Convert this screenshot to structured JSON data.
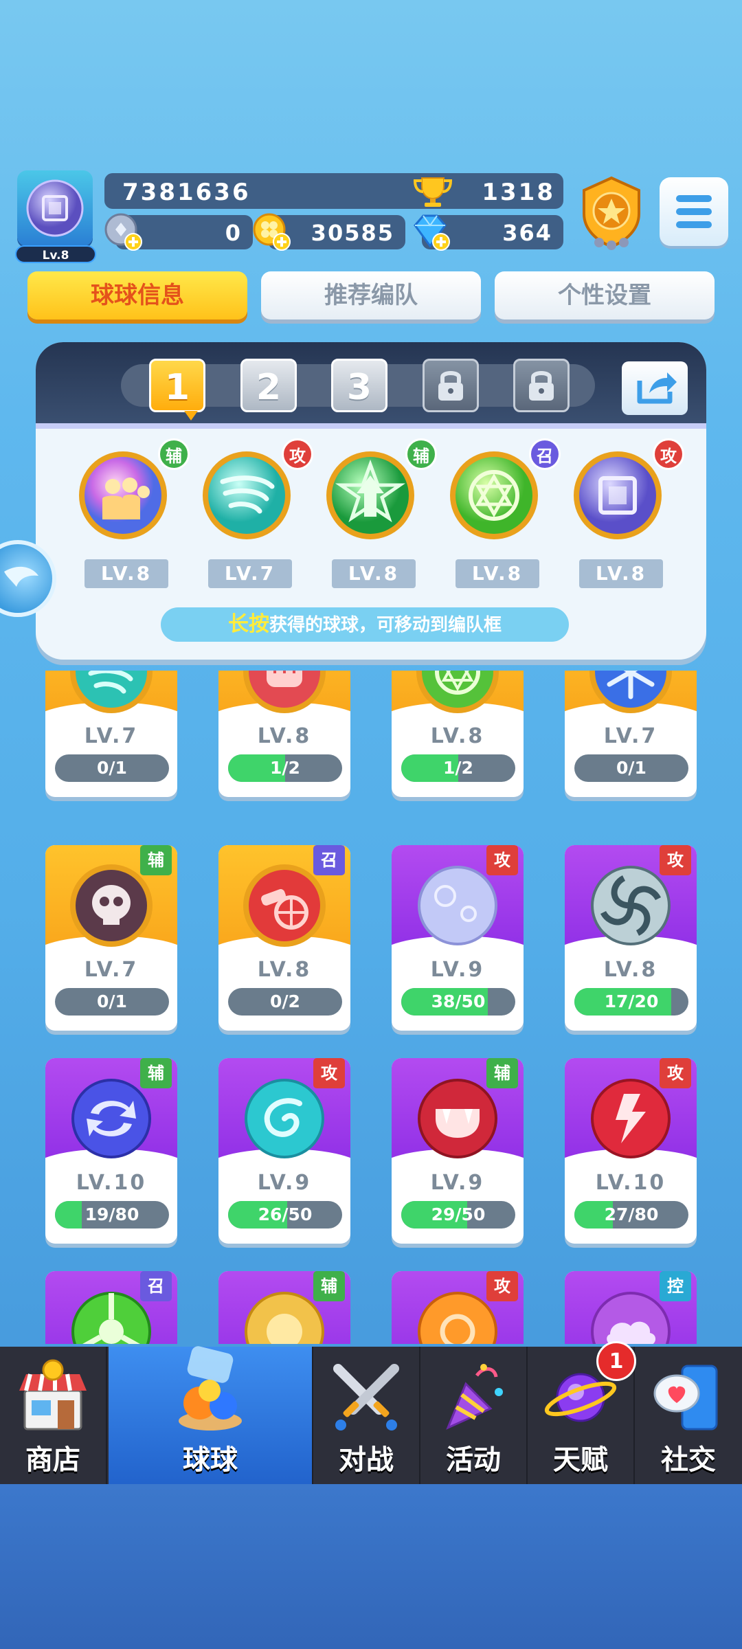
{
  "player": {
    "level_label": "Lv.8",
    "score": "7381636",
    "trophies": "1318",
    "silver_coins": "0",
    "clover_coins": "30585",
    "gems": "364"
  },
  "tabs": [
    "球球信息",
    "推荐编队",
    "个性设置"
  ],
  "formation": {
    "slots": [
      "1",
      "2",
      "3"
    ],
    "team": [
      {
        "tag": "辅",
        "level": "LV.8"
      },
      {
        "tag": "攻",
        "level": "LV.7"
      },
      {
        "tag": "辅",
        "level": "LV.8"
      },
      {
        "tag": "召",
        "level": "LV.8"
      },
      {
        "tag": "攻",
        "level": "LV.8"
      }
    ],
    "hint_highlight": "长按",
    "hint_rest": "获得的球球，可移动到编队框"
  },
  "cards": [
    {
      "level": "LV.7",
      "progress": "0/1",
      "fill": 0.0
    },
    {
      "level": "LV.8",
      "progress": "1/2",
      "fill": 0.5
    },
    {
      "level": "LV.8",
      "progress": "1/2",
      "fill": 0.5
    },
    {
      "level": "LV.7",
      "progress": "0/1",
      "fill": 0.0
    },
    {
      "tag": "辅",
      "level": "LV.7",
      "progress": "0/1",
      "fill": 0.0
    },
    {
      "tag": "召",
      "level": "LV.8",
      "progress": "0/2",
      "fill": 0.0
    },
    {
      "tag": "攻",
      "level": "LV.9",
      "progress": "38/50",
      "fill": 0.76
    },
    {
      "tag": "攻",
      "level": "LV.8",
      "progress": "17/20",
      "fill": 0.85
    },
    {
      "tag": "辅",
      "level": "LV.10",
      "progress": "19/80",
      "fill": 0.2375
    },
    {
      "tag": "攻",
      "level": "LV.9",
      "progress": "26/50",
      "fill": 0.52
    },
    {
      "tag": "辅",
      "level": "LV.9",
      "progress": "29/50",
      "fill": 0.58
    },
    {
      "tag": "攻",
      "level": "LV.10",
      "progress": "27/80",
      "fill": 0.3375
    },
    {
      "tag": "召"
    },
    {
      "tag": "辅"
    },
    {
      "tag": "攻"
    },
    {
      "tag": "控"
    }
  ],
  "nav": [
    "商店",
    "球球",
    "对战",
    "活动",
    "天赋",
    "社交"
  ],
  "talent_badge": "1",
  "colors": {
    "accent_yellow": "#ffc21a",
    "tab_active_text": "#e4521b",
    "nav_active": "#2f7be2",
    "progress_green": "#3fd46a",
    "card_gold": "#f9a51b",
    "card_purple": "#9a36e8"
  }
}
